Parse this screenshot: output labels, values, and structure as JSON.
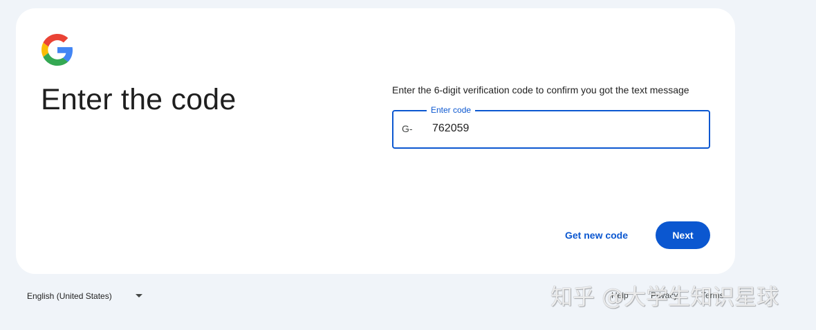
{
  "card": {
    "logo_icon": "google-g-icon",
    "title": "Enter the code",
    "instruction": "Enter the 6-digit verification code to confirm you got the text message",
    "code_field": {
      "label": "Enter code",
      "prefix": "G-",
      "value": "762059"
    },
    "get_new_code_label": "Get new code",
    "next_label": "Next"
  },
  "footer": {
    "language": "English (United States)",
    "links": [
      "Help",
      "Privacy",
      "Terms"
    ]
  },
  "watermark": "知乎 @大学生知识星球",
  "colors": {
    "accent": "#0b57d0",
    "page_background": "#f0f4f9",
    "card_background": "#ffffff"
  }
}
